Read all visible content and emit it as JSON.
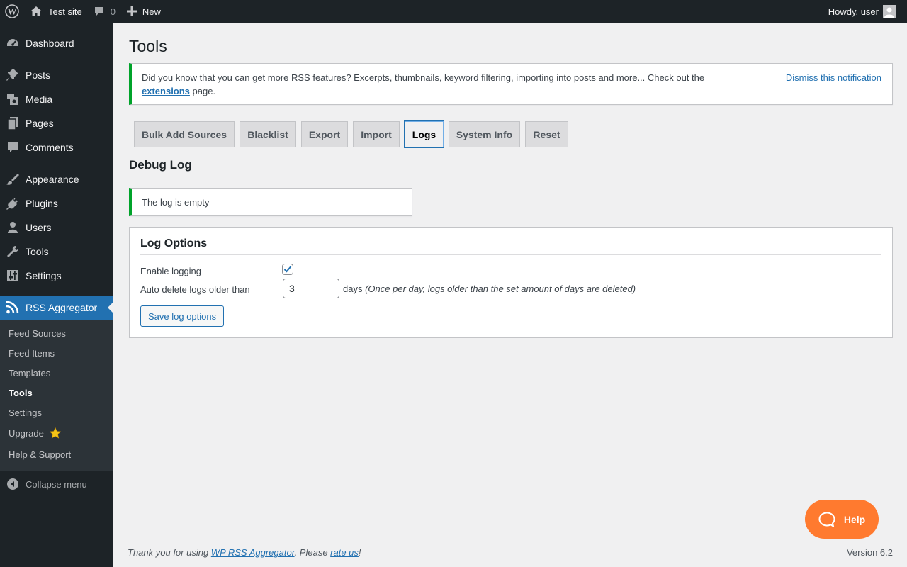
{
  "adminbar": {
    "site_name": "Test site",
    "comments_count": "0",
    "new_label": "New",
    "howdy": "Howdy, user"
  },
  "sidebar": {
    "items": [
      {
        "label": "Dashboard",
        "icon": "dashboard-icon"
      },
      {
        "label": "Posts",
        "icon": "pin-icon"
      },
      {
        "label": "Media",
        "icon": "media-icon"
      },
      {
        "label": "Pages",
        "icon": "pages-icon"
      },
      {
        "label": "Comments",
        "icon": "comment-icon"
      },
      {
        "label": "Appearance",
        "icon": "brush-icon"
      },
      {
        "label": "Plugins",
        "icon": "plug-icon"
      },
      {
        "label": "Users",
        "icon": "user-icon"
      },
      {
        "label": "Tools",
        "icon": "wrench-icon"
      },
      {
        "label": "Settings",
        "icon": "settings-icon"
      },
      {
        "label": "RSS Aggregator",
        "icon": "rss-icon"
      }
    ],
    "submenu": [
      {
        "label": "Feed Sources"
      },
      {
        "label": "Feed Items"
      },
      {
        "label": "Templates"
      },
      {
        "label": "Tools"
      },
      {
        "label": "Settings"
      },
      {
        "label": "Upgrade",
        "icon": "star-icon"
      },
      {
        "label": "Help & Support"
      }
    ],
    "collapse_label": "Collapse menu"
  },
  "page": {
    "title": "Tools",
    "promo_notice": {
      "text_before": "Did you know that you can get more RSS features? Excerpts, thumbnails, keyword filtering, importing into posts and more... Check out the ",
      "link_text": "extensions",
      "text_after": " page.",
      "dismiss_label": "Dismiss this notification"
    },
    "tabs": [
      {
        "label": "Bulk Add Sources"
      },
      {
        "label": "Blacklist"
      },
      {
        "label": "Export"
      },
      {
        "label": "Import"
      },
      {
        "label": "Logs",
        "active": true
      },
      {
        "label": "System Info"
      },
      {
        "label": "Reset"
      }
    ],
    "section_title": "Debug Log",
    "log_notice": "The log is empty",
    "log_options": {
      "title": "Log Options",
      "enable_label": "Enable logging",
      "enable_checked": true,
      "auto_delete_label": "Auto delete logs older than",
      "auto_delete_value": "3",
      "days_label": "days",
      "days_note": "(Once per day, logs older than the set amount of days are deleted)",
      "save_label": "Save log options"
    }
  },
  "help_button": "Help",
  "footer": {
    "thanks_before": "Thank you for using ",
    "plugin_link": "WP RSS Aggregator",
    "thanks_middle": ". Please ",
    "rate_link": "rate us",
    "thanks_after": "!",
    "version": "Version 6.2"
  },
  "colors": {
    "adminbar_bg": "#1d2327",
    "sidebar_bg": "#1d2327",
    "submenu_bg": "#2c3338",
    "accent": "#2271b1",
    "success": "#00a32a",
    "help_orange": "#ff7a2f"
  }
}
